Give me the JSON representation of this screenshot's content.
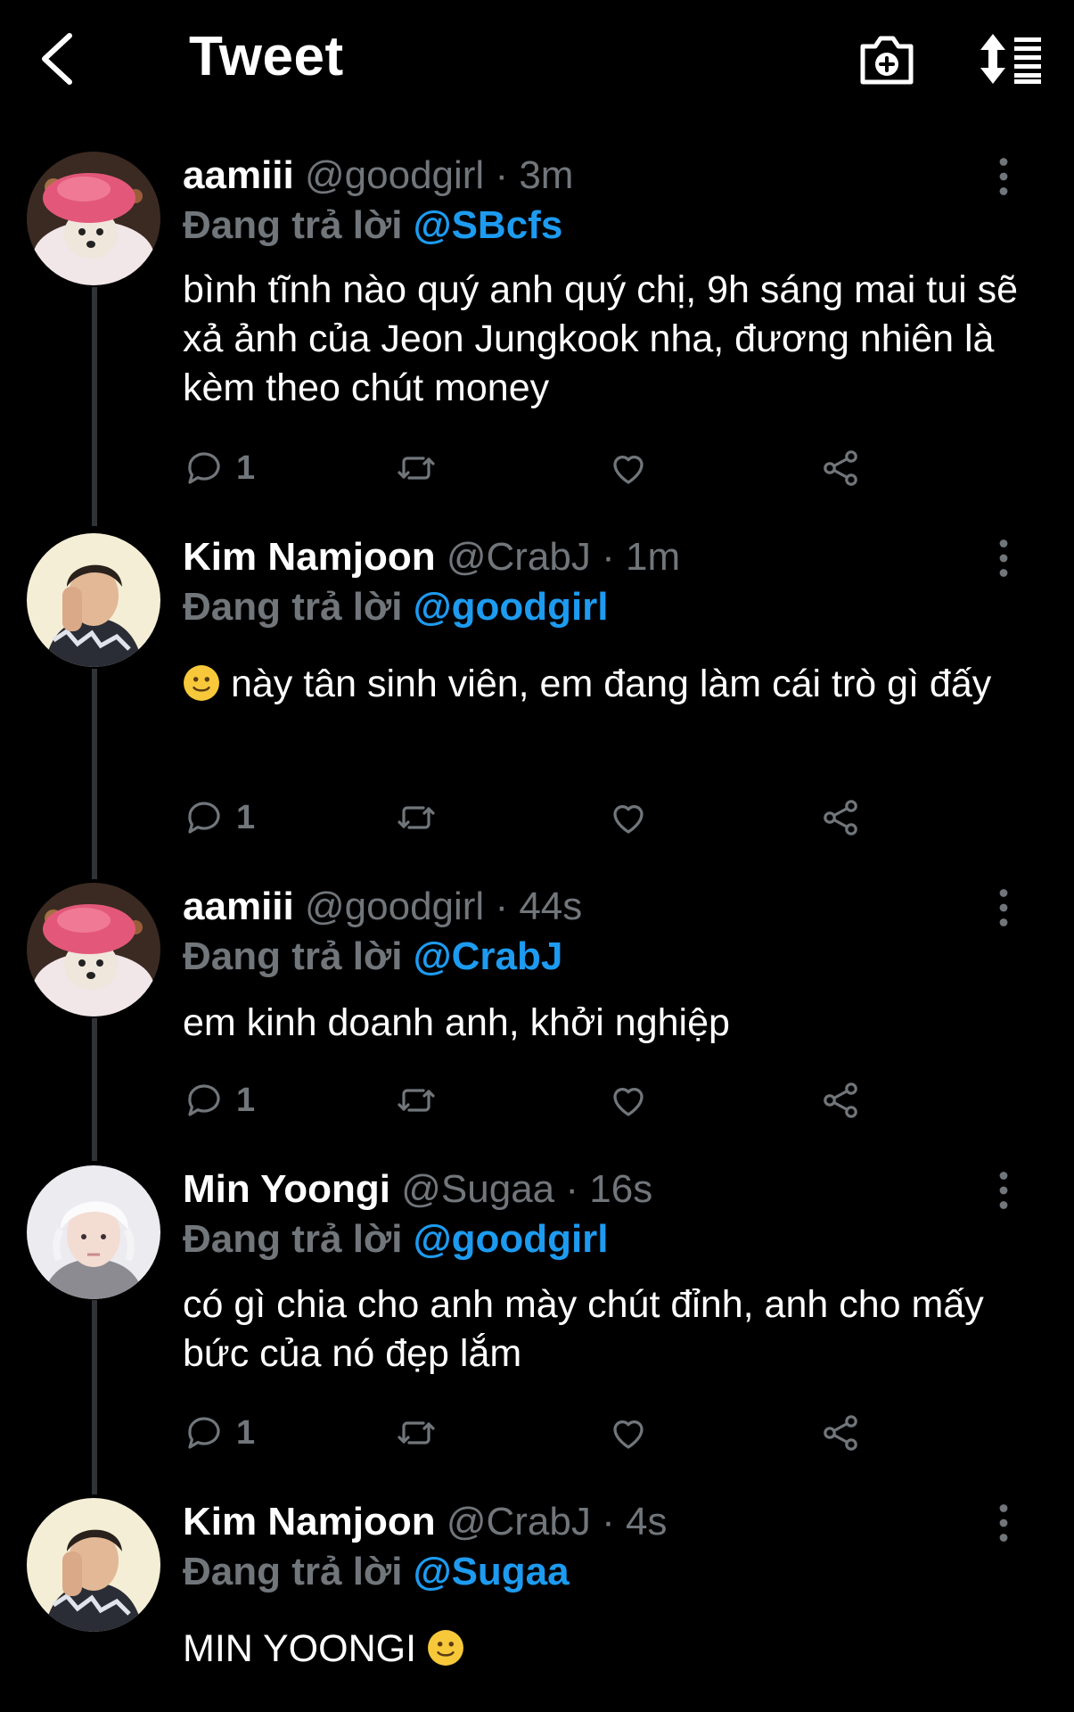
{
  "header": {
    "title": "Tweet"
  },
  "reply_prefix": "Đang trả lời",
  "tweets": [
    {
      "name": "aamiii",
      "handle": "@goodgirl",
      "time": "· 3m",
      "replying_to": "@SBcfs",
      "text": "bình tĩnh nào quý anh quý chị, 9h sáng mai tui sẽ xả ảnh của Jeon Jungkook nha, đương nhiên là kèm theo chút money",
      "reply_count": "1"
    },
    {
      "name": "Kim Namjoon",
      "handle": "@CrabJ",
      "time": "· 1m",
      "replying_to": "@goodgirl",
      "text": "này tân sinh viên, em đang làm cái trò gì đấy",
      "reply_count": "1"
    },
    {
      "name": "aamiii",
      "handle": "@goodgirl",
      "time": "· 44s",
      "replying_to": "@CrabJ",
      "text": "em kinh doanh anh, khởi nghiệp",
      "reply_count": "1"
    },
    {
      "name": "Min Yoongi",
      "handle": "@Sugaa",
      "time": "· 16s",
      "replying_to": "@goodgirl",
      "text": "có gì chia cho anh mày chút đỉnh, anh cho mấy bức của nó đẹp lắm",
      "reply_count": "1"
    },
    {
      "name": "Kim Namjoon",
      "handle": "@CrabJ",
      "time": "· 4s",
      "replying_to": "@Sugaa",
      "text": "MIN YOONGI",
      "reply_count": ""
    }
  ],
  "colors": {
    "background": "#000000",
    "secondary_text": "#71767b",
    "mention": "#1d9bf0",
    "thread_line": "#2f3336"
  },
  "icons": [
    "back-arrow-icon",
    "camera-plus-icon",
    "sort-icon",
    "more-vertical-icon",
    "reply-icon",
    "retweet-icon",
    "like-icon",
    "share-icon",
    "slight-smile-emoji"
  ]
}
